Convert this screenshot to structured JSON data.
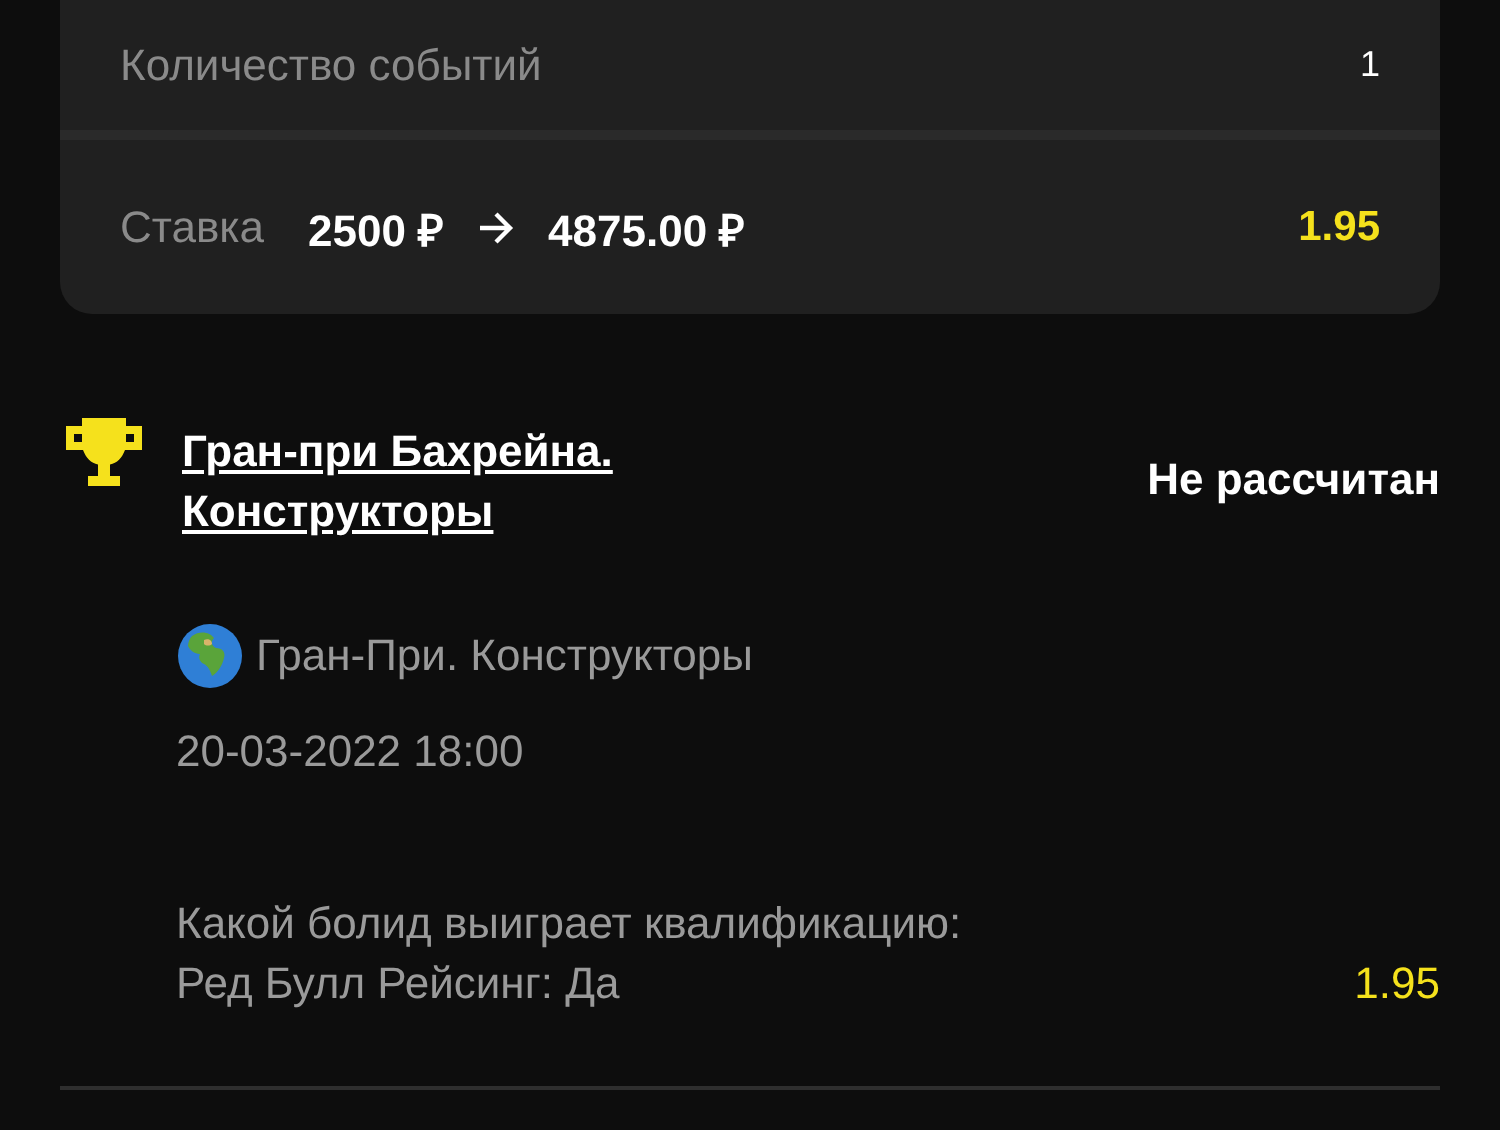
{
  "summary": {
    "rows": [
      {
        "kind": "count",
        "label": "Количество событий",
        "value": "1"
      },
      {
        "kind": "stake",
        "label": "Ставка",
        "stake": "2500 ₽",
        "payout": "4875.00 ₽",
        "odds": "1.95"
      }
    ]
  },
  "event": {
    "title": "Гран-при Бахрейна. Конструкторы",
    "status": "Не рассчитан",
    "tournament": "Гран-При. Конструкторы",
    "date": "20-03-2022 18:00",
    "market": "Какой болид выиграет квалификацию:",
    "selection": "Ред Булл Рейсинг: Да",
    "odds": "1.95"
  }
}
